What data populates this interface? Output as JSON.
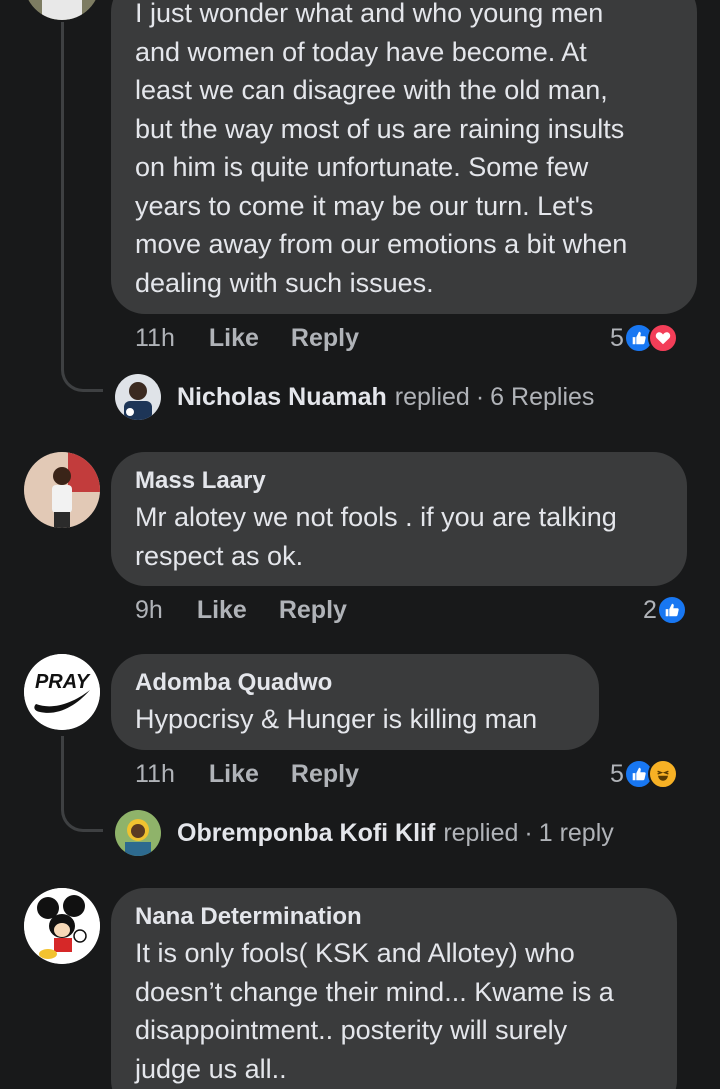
{
  "comments": [
    {
      "text": "I just wonder what and who young men\nand women of today have become. At\nleast we can disagree with the old man,\nbut the way most of us are raining insults\non him is quite unfortunate. Some few\nyears to come it may be our turn. Let's\nmove away from our emotions a bit when\ndealing with such issues.",
      "time": "11h",
      "like_label": "Like",
      "reply_label": "Reply",
      "reaction_count": "5",
      "reactions": [
        "like",
        "love"
      ],
      "replies": {
        "name": "Nicholas Nuamah",
        "action": "replied",
        "sep": "·",
        "count": "6 Replies"
      }
    },
    {
      "author": "Mass Laary",
      "text": "Mr alotey we not fools . if you are talking\nrespect as ok.",
      "time": "9h",
      "like_label": "Like",
      "reply_label": "Reply",
      "reaction_count": "2",
      "reactions": [
        "like"
      ]
    },
    {
      "author": "Adomba Quadwo",
      "avatar_text": "PRAY",
      "text": "Hypocrisy & Hunger is killing man",
      "time": "11h",
      "like_label": "Like",
      "reply_label": "Reply",
      "reaction_count": "5",
      "reactions": [
        "like",
        "haha"
      ],
      "replies": {
        "name": "Obremponba Kofi Klif",
        "action": "replied",
        "sep": "·",
        "count": "1 reply"
      }
    },
    {
      "author": "Nana Determination",
      "text": "It is only fools( KSK and Allotey) who\ndoesn’t change their mind... Kwame is a\ndisappointment.. posterity will surely\njudge us all.."
    }
  ],
  "colors": {
    "background": "#18191a",
    "bubble": "#3a3b3c",
    "text": "#e4e6eb",
    "muted": "#b0b3b8",
    "like_blue": "#1877f2",
    "love_red": "#f33e58",
    "haha_yellow": "#f7b125"
  },
  "icons": {
    "like": "thumbs-up-icon",
    "love": "heart-icon",
    "haha": "laughing-face-icon"
  }
}
